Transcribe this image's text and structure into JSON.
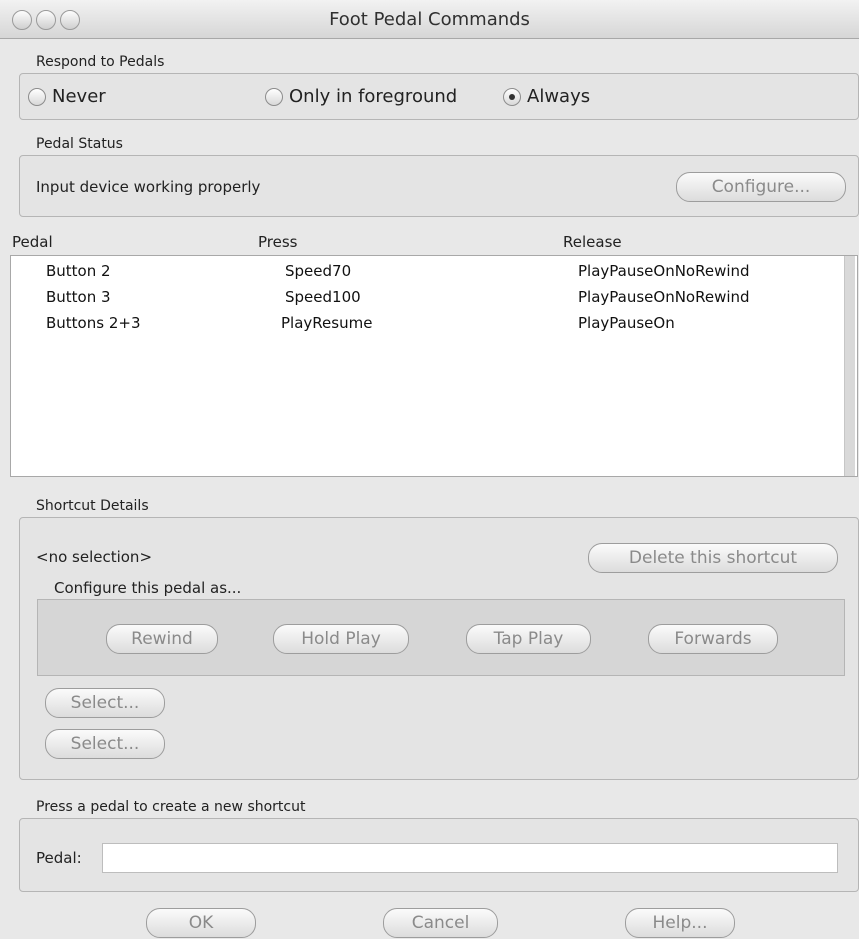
{
  "window": {
    "title": "Foot Pedal Commands"
  },
  "respond": {
    "label": "Respond to Pedals",
    "options": [
      {
        "label": "Never",
        "selected": false
      },
      {
        "label": "Only in foreground",
        "selected": false
      },
      {
        "label": "Always",
        "selected": true
      }
    ]
  },
  "status": {
    "label": "Pedal Status",
    "message": "Input device working properly",
    "configure_label": "Configure..."
  },
  "table": {
    "headers": [
      "Pedal",
      "Press",
      "Release"
    ],
    "rows": [
      [
        "Button 2",
        "Speed70",
        "PlayPauseOnNoRewind"
      ],
      [
        "Button 3",
        "Speed100",
        "PlayPauseOnNoRewind"
      ],
      [
        "Buttons 2+3",
        "PlayResume",
        "PlayPauseOn"
      ]
    ]
  },
  "details": {
    "label": "Shortcut Details",
    "selection_text": "<no selection>",
    "delete_label": "Delete this shortcut",
    "configure_as_label": "Configure this pedal as...",
    "modes": [
      "Rewind",
      "Hold Play",
      "Tap Play",
      "Forwards"
    ],
    "select_labels": [
      "Select...",
      "Select..."
    ]
  },
  "create": {
    "label": "Press a pedal to create a new shortcut",
    "pedal_label": "Pedal:",
    "pedal_value": ""
  },
  "footer": {
    "ok_label": "OK",
    "cancel_label": "Cancel",
    "help_label": "Help..."
  }
}
